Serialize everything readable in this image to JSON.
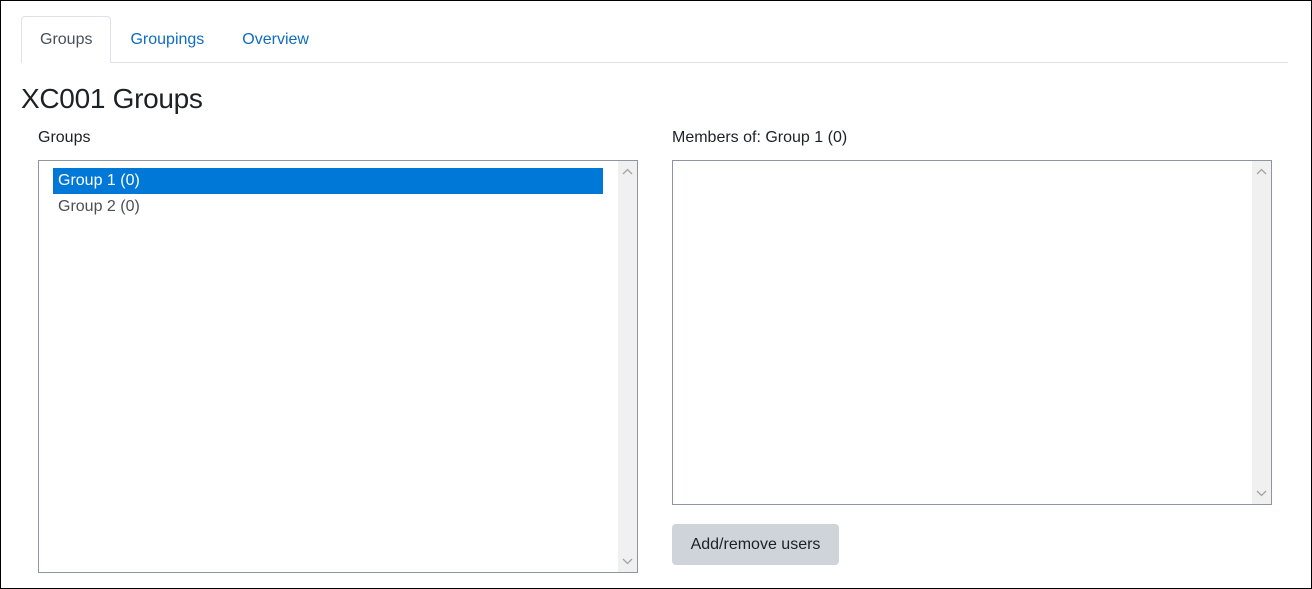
{
  "tabs": [
    {
      "label": "Groups",
      "active": true
    },
    {
      "label": "Groupings",
      "active": false
    },
    {
      "label": "Overview",
      "active": false
    }
  ],
  "page": {
    "title": "XC001 Groups"
  },
  "groups_panel": {
    "label": "Groups",
    "options": [
      {
        "label": "Group 1 (0)",
        "selected": true
      },
      {
        "label": "Group 2 (0)",
        "selected": false
      }
    ]
  },
  "members_panel": {
    "label": "Members of: Group 1 (0)",
    "options": []
  },
  "actions": {
    "add_remove_label": "Add/remove users"
  },
  "colors": {
    "link": "#0f6cbf",
    "selection": "#0078d7",
    "button_bg": "#ced4da"
  },
  "icons": {
    "scroll_up": "chevron-up-icon",
    "scroll_down": "chevron-down-icon"
  }
}
